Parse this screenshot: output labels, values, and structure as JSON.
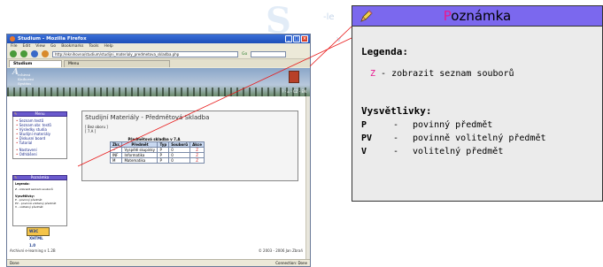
{
  "watermark": {
    "big": "S",
    "small": "-le",
    "small2": "v"
  },
  "browser": {
    "title": "Studium - Mozilla Firefox",
    "menu": [
      "File",
      "Edit",
      "View",
      "Go",
      "Bookmarks",
      "Tools",
      "Help"
    ],
    "url": "http://eknihovna/studium/studijni_materialy_predmetova_skladba.php",
    "go_label": "Go",
    "tabs": [
      {
        "label": "Studium"
      },
      {
        "label": "Menu"
      }
    ],
    "status": "Done",
    "status_right": "Connection: Done"
  },
  "site": {
    "logo_big": "A",
    "logo_lines": [
      "rchivni",
      "Knihovni",
      "Systém"
    ],
    "banner_icons": "? - ⌂ - CZ - EN"
  },
  "menu_panel": {
    "title": "Menu",
    "items": [
      "Seznam testů",
      "Seznam obr. testů",
      "Výsledky studia",
      "Studijní materiály",
      "Diskusní board",
      "Tutorial",
      "Nastavení",
      "Odhlášení"
    ]
  },
  "note_panel_small": {
    "title": "Poznámka",
    "legend": "Legenda:",
    "legend_row": "Z - zobrazit seznam souborů",
    "vys": "Vysvětlivky:",
    "items": [
      "P - povinný předmět",
      "PV - povinně volitelný předmět",
      "V - volitelný předmět"
    ]
  },
  "w3c": "W3C XHTML 1.0",
  "main": {
    "title": "Studijní Materiály - Předmětová Skladba",
    "filter1": "[ Bez oboru ]",
    "filter2": "[ 7.A ]",
    "table_caption": "Předmětová skladba v 7.A",
    "headers": [
      "Zkr.",
      "Předmět",
      "Typ",
      "Souborů",
      "Akce"
    ],
    "rows": [
      [
        "--",
        "Vyspělé skupinky",
        "P",
        "0",
        "Z"
      ],
      [
        "INF",
        "Informatika",
        "P",
        "0",
        "Z"
      ],
      [
        "M",
        "Matematika",
        "P",
        "0",
        "Z"
      ]
    ]
  },
  "footer": {
    "left": "Archivní e-learning v 1.2B",
    "right": "© 2003 - 2006 Jan Zbraň"
  },
  "note_zoom": {
    "title_first": "P",
    "title_rest": "oznámka",
    "legend": "Legenda:",
    "legend_key": "Z",
    "legend_text": " - zobrazit seznam souborů",
    "vys": "Vysvětlivky:",
    "items": [
      {
        "key": "P",
        "dash": "-",
        "text": "povinný předmět"
      },
      {
        "key": "PV",
        "dash": "-",
        "text": "povinně volitelný předmět"
      },
      {
        "key": "V",
        "dash": "-",
        "text": "volitelný předmět"
      }
    ]
  },
  "colors": {
    "accent_purple": "#7b68ee",
    "accent_pink": "#e81890",
    "connector": "#e81818"
  }
}
